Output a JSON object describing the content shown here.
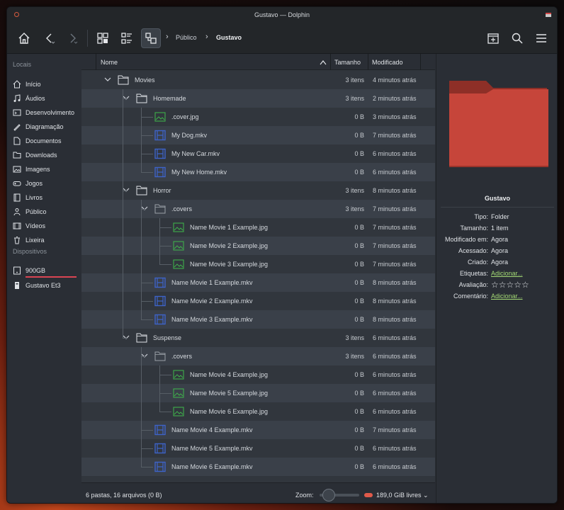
{
  "window": {
    "title": "Gustavo — Dolphin"
  },
  "breadcrumb": {
    "items": [
      "Público",
      "Gustavo"
    ]
  },
  "sidebar": {
    "places_header": "Locais",
    "places": [
      {
        "label": "Início",
        "icon": "home-icon"
      },
      {
        "label": "Áudios",
        "icon": "music-icon"
      },
      {
        "label": "Desenvolvimento",
        "icon": "terminal-icon"
      },
      {
        "label": "Diagramação",
        "icon": "pen-icon"
      },
      {
        "label": "Documentos",
        "icon": "document-icon"
      },
      {
        "label": "Downloads",
        "icon": "folder-icon"
      },
      {
        "label": "Imagens",
        "icon": "image-icon"
      },
      {
        "label": "Jogos",
        "icon": "gamepad-icon"
      },
      {
        "label": "Livros",
        "icon": "book-icon"
      },
      {
        "label": "Público",
        "icon": "people-icon"
      },
      {
        "label": "Vídeos",
        "icon": "film-icon"
      },
      {
        "label": "Lixeira",
        "icon": "trash-icon"
      }
    ],
    "devices_header": "Dispositivos",
    "devices": [
      {
        "label": "900GB",
        "icon": "drive-icon",
        "usage": 1.0
      },
      {
        "label": "Gustavo Et3",
        "icon": "usb-drive-icon"
      }
    ]
  },
  "columns": {
    "name": "Nome",
    "size": "Tamanho",
    "modified": "Modificado"
  },
  "files": [
    {
      "name": "Movies",
      "type": "folder",
      "depth": 0,
      "size": "3 itens",
      "modified": "4 minutos atrás"
    },
    {
      "name": "Homemade",
      "type": "folder",
      "depth": 1,
      "size": "3 itens",
      "modified": "2 minutos atrás"
    },
    {
      "name": ".cover.jpg",
      "type": "image",
      "depth": 2,
      "size": "0 B",
      "modified": "3 minutos atrás"
    },
    {
      "name": "My Dog.mkv",
      "type": "video",
      "depth": 2,
      "size": "0 B",
      "modified": "7 minutos atrás"
    },
    {
      "name": "My New Car.mkv",
      "type": "video",
      "depth": 2,
      "size": "0 B",
      "modified": "6 minutos atrás"
    },
    {
      "name": "My New Home.mkv",
      "type": "video",
      "depth": 2,
      "size": "0 B",
      "modified": "6 minutos atrás"
    },
    {
      "name": "Horror",
      "type": "folder",
      "depth": 1,
      "size": "3 itens",
      "modified": "8 minutos atrás"
    },
    {
      "name": ".covers",
      "type": "folder-hidden",
      "depth": 2,
      "size": "3 itens",
      "modified": "7 minutos atrás"
    },
    {
      "name": "Name Movie 1 Example.jpg",
      "type": "image",
      "depth": 3,
      "size": "0 B",
      "modified": "7 minutos atrás"
    },
    {
      "name": "Name Movie 2 Example.jpg",
      "type": "image",
      "depth": 3,
      "size": "0 B",
      "modified": "7 minutos atrás"
    },
    {
      "name": "Name Movie 3 Example.jpg",
      "type": "image",
      "depth": 3,
      "size": "0 B",
      "modified": "7 minutos atrás"
    },
    {
      "name": "Name Movie 1 Example.mkv",
      "type": "video",
      "depth": 2,
      "size": "0 B",
      "modified": "8 minutos atrás"
    },
    {
      "name": "Name Movie 2 Example.mkv",
      "type": "video",
      "depth": 2,
      "size": "0 B",
      "modified": "8 minutos atrás"
    },
    {
      "name": "Name Movie 3 Example.mkv",
      "type": "video",
      "depth": 2,
      "size": "0 B",
      "modified": "8 minutos atrás"
    },
    {
      "name": "Suspense",
      "type": "folder",
      "depth": 1,
      "size": "3 itens",
      "modified": "6 minutos atrás"
    },
    {
      "name": ".covers",
      "type": "folder-hidden",
      "depth": 2,
      "size": "3 itens",
      "modified": "6 minutos atrás"
    },
    {
      "name": "Name Movie 4 Example.jpg",
      "type": "image",
      "depth": 3,
      "size": "0 B",
      "modified": "6 minutos atrás"
    },
    {
      "name": "Name Movie 5 Example.jpg",
      "type": "image",
      "depth": 3,
      "size": "0 B",
      "modified": "6 minutos atrás"
    },
    {
      "name": "Name Movie 6 Example.jpg",
      "type": "image",
      "depth": 3,
      "size": "0 B",
      "modified": "6 minutos atrás"
    },
    {
      "name": "Name Movie 4 Example.mkv",
      "type": "video",
      "depth": 2,
      "size": "0 B",
      "modified": "7 minutos atrás"
    },
    {
      "name": "Name Movie 5 Example.mkv",
      "type": "video",
      "depth": 2,
      "size": "0 B",
      "modified": "6 minutos atrás"
    },
    {
      "name": "Name Movie 6 Example.mkv",
      "type": "video",
      "depth": 2,
      "size": "0 B",
      "modified": "6 minutos atrás"
    }
  ],
  "status": {
    "summary": "6 pastas, 16 arquivos (0 B)",
    "zoom_label": "Zoom:",
    "zoom_level": 0.1,
    "free_space": "189,0 GiB livres"
  },
  "info_panel": {
    "name": "Gustavo",
    "fields": [
      {
        "key": "Tipo:",
        "value": "Folder"
      },
      {
        "key": "Tamanho:",
        "value": "1 item"
      },
      {
        "key": "Modificado em:",
        "value": "Agora"
      },
      {
        "key": "Acessado:",
        "value": "Agora"
      },
      {
        "key": "Criado:",
        "value": "Agora"
      },
      {
        "key": "Etiquetas:",
        "value": "Adicionar...",
        "link": true
      },
      {
        "key": "Avaliação:",
        "value": "☆☆☆☆☆",
        "stars": true
      },
      {
        "key": "Comentário:",
        "value": "Adicionar...",
        "link": true
      }
    ]
  },
  "colors": {
    "folder_preview": "#c6453a",
    "accent_link": "#a3d974",
    "image_icon": "#3fae4b",
    "video_icon": "#3d63c9"
  }
}
